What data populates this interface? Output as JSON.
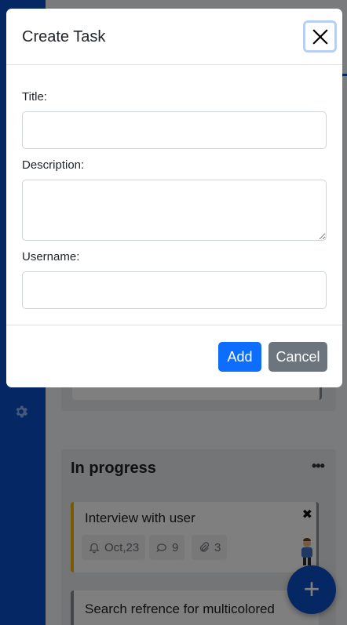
{
  "background": {
    "column": {
      "title": "In progress",
      "more_icon": "more-horizontal-icon",
      "cards": [
        {
          "title": "Interview with user",
          "accent": "#f0b400",
          "due_date": "Oct,23",
          "comments": "9",
          "attachments": "3"
        },
        {
          "title": "Search refrence for multicolored"
        }
      ]
    },
    "fab_label": "+",
    "sidebar_icon": "gear-icon"
  },
  "modal": {
    "title": "Create Task",
    "close_icon": "close-icon",
    "fields": {
      "title_label": "Title:",
      "title_value": "",
      "description_label": "Description:",
      "description_value": "",
      "username_label": "Username:",
      "username_value": ""
    },
    "buttons": {
      "add": "Add",
      "cancel": "Cancel"
    }
  },
  "colors": {
    "primary": "#0d6efd",
    "secondary": "#6c757d",
    "sidebar": "#0a4fc8"
  }
}
